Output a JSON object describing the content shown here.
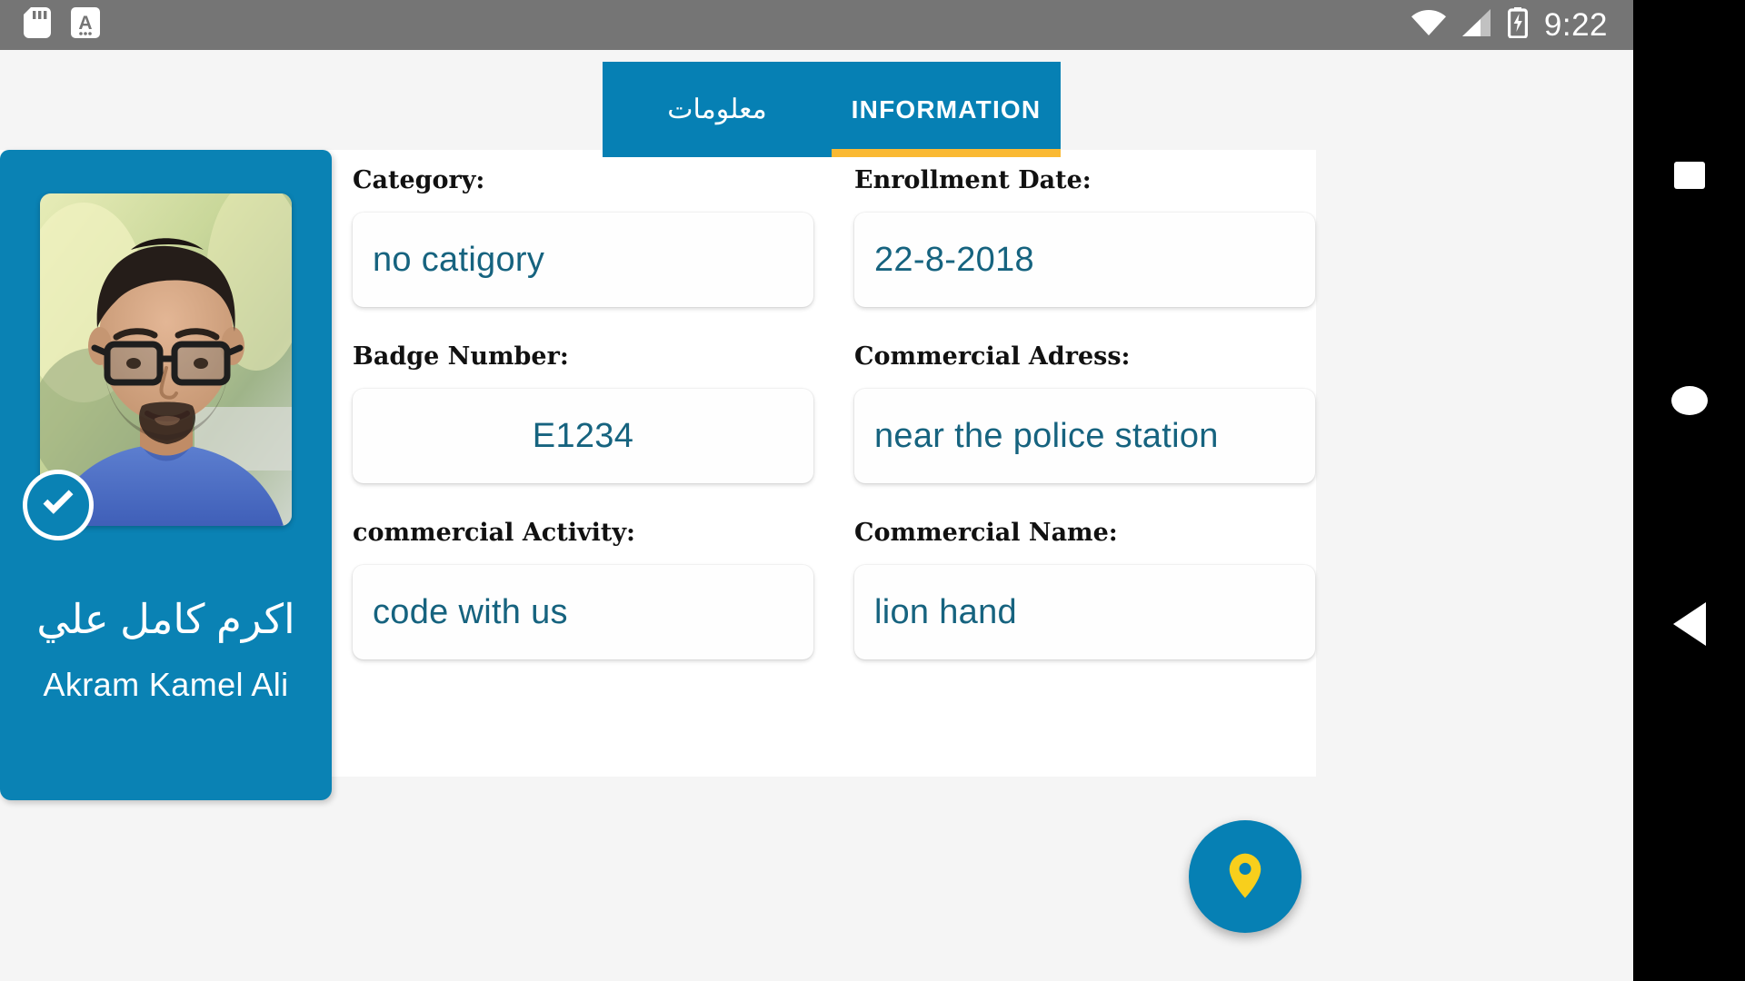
{
  "statusbar": {
    "time": "9:22",
    "icons": [
      "sd-card-icon",
      "keyboard-input-icon",
      "wifi-icon",
      "cellular-signal-icon",
      "battery-charging-icon"
    ]
  },
  "navbar": {
    "recents_label": "recents-square",
    "home_label": "home-circle",
    "back_label": "back-triangle"
  },
  "tabs": [
    {
      "label": "معلومات",
      "selected": false
    },
    {
      "label": "INFORMATION",
      "selected": true
    }
  ],
  "profile": {
    "name_ar": "اكرم كامل علي",
    "name_en": "Akram Kamel Ali",
    "verified": true,
    "photo_alt": "portrait-photo"
  },
  "fields": [
    {
      "label": "Category:",
      "value": "no catigory",
      "align": "left"
    },
    {
      "label": "Enrollment Date:",
      "value": "22-8-2018",
      "align": "left"
    },
    {
      "label": "Badge Number:",
      "value": "E1234",
      "align": "center"
    },
    {
      "label": "Commercial Adress:",
      "value": "near the police station",
      "align": "left"
    },
    {
      "label": "commercial Activity:",
      "value": "code with us",
      "align": "left"
    },
    {
      "label": "Commercial Name:",
      "value": "lion hand",
      "align": "left"
    }
  ],
  "fab": {
    "icon": "map-pin-icon"
  },
  "colors": {
    "brand_blue": "#0680b4",
    "card_blue": "#0a82b4",
    "accent_yellow": "#fab933",
    "value_teal": "#16637f",
    "statusbar_gray": "#757575",
    "page_bg": "#f5f5f5"
  }
}
